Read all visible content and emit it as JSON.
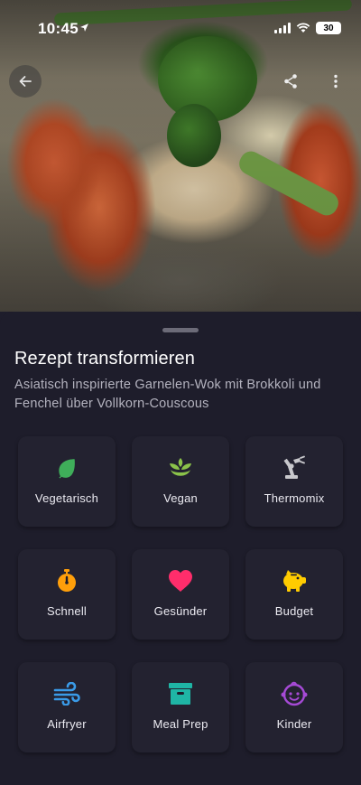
{
  "status_bar": {
    "time": "10:45",
    "battery": "30"
  },
  "header": {
    "back_icon": "arrow-left-icon",
    "share_icon": "share-icon",
    "more_icon": "more-vertical-icon"
  },
  "sheet": {
    "title": "Rezept transformieren",
    "subtitle": "Asiatisch inspirierte Garnelen-Wok mit Brokkoli und Fenchel über Vollkorn-Couscous"
  },
  "options": [
    {
      "label": "Vegetarisch",
      "icon": "leaf-icon",
      "color": "#3fae5a"
    },
    {
      "label": "Vegan",
      "icon": "sprout-icon",
      "color": "#8bc34a"
    },
    {
      "label": "Thermomix",
      "icon": "robot-arm-icon",
      "color": "#c8c8cc"
    },
    {
      "label": "Schnell",
      "icon": "stopwatch-icon",
      "color": "#ff9f0a"
    },
    {
      "label": "Gesünder",
      "icon": "heart-icon",
      "color": "#ff2d6b"
    },
    {
      "label": "Budget",
      "icon": "piggy-bank-icon",
      "color": "#ffcc00"
    },
    {
      "label": "Airfryer",
      "icon": "wind-icon",
      "color": "#3a9be8"
    },
    {
      "label": "Meal Prep",
      "icon": "archive-box-icon",
      "color": "#1fb5a5"
    },
    {
      "label": "Kinder",
      "icon": "baby-face-icon",
      "color": "#a64ad6"
    }
  ]
}
